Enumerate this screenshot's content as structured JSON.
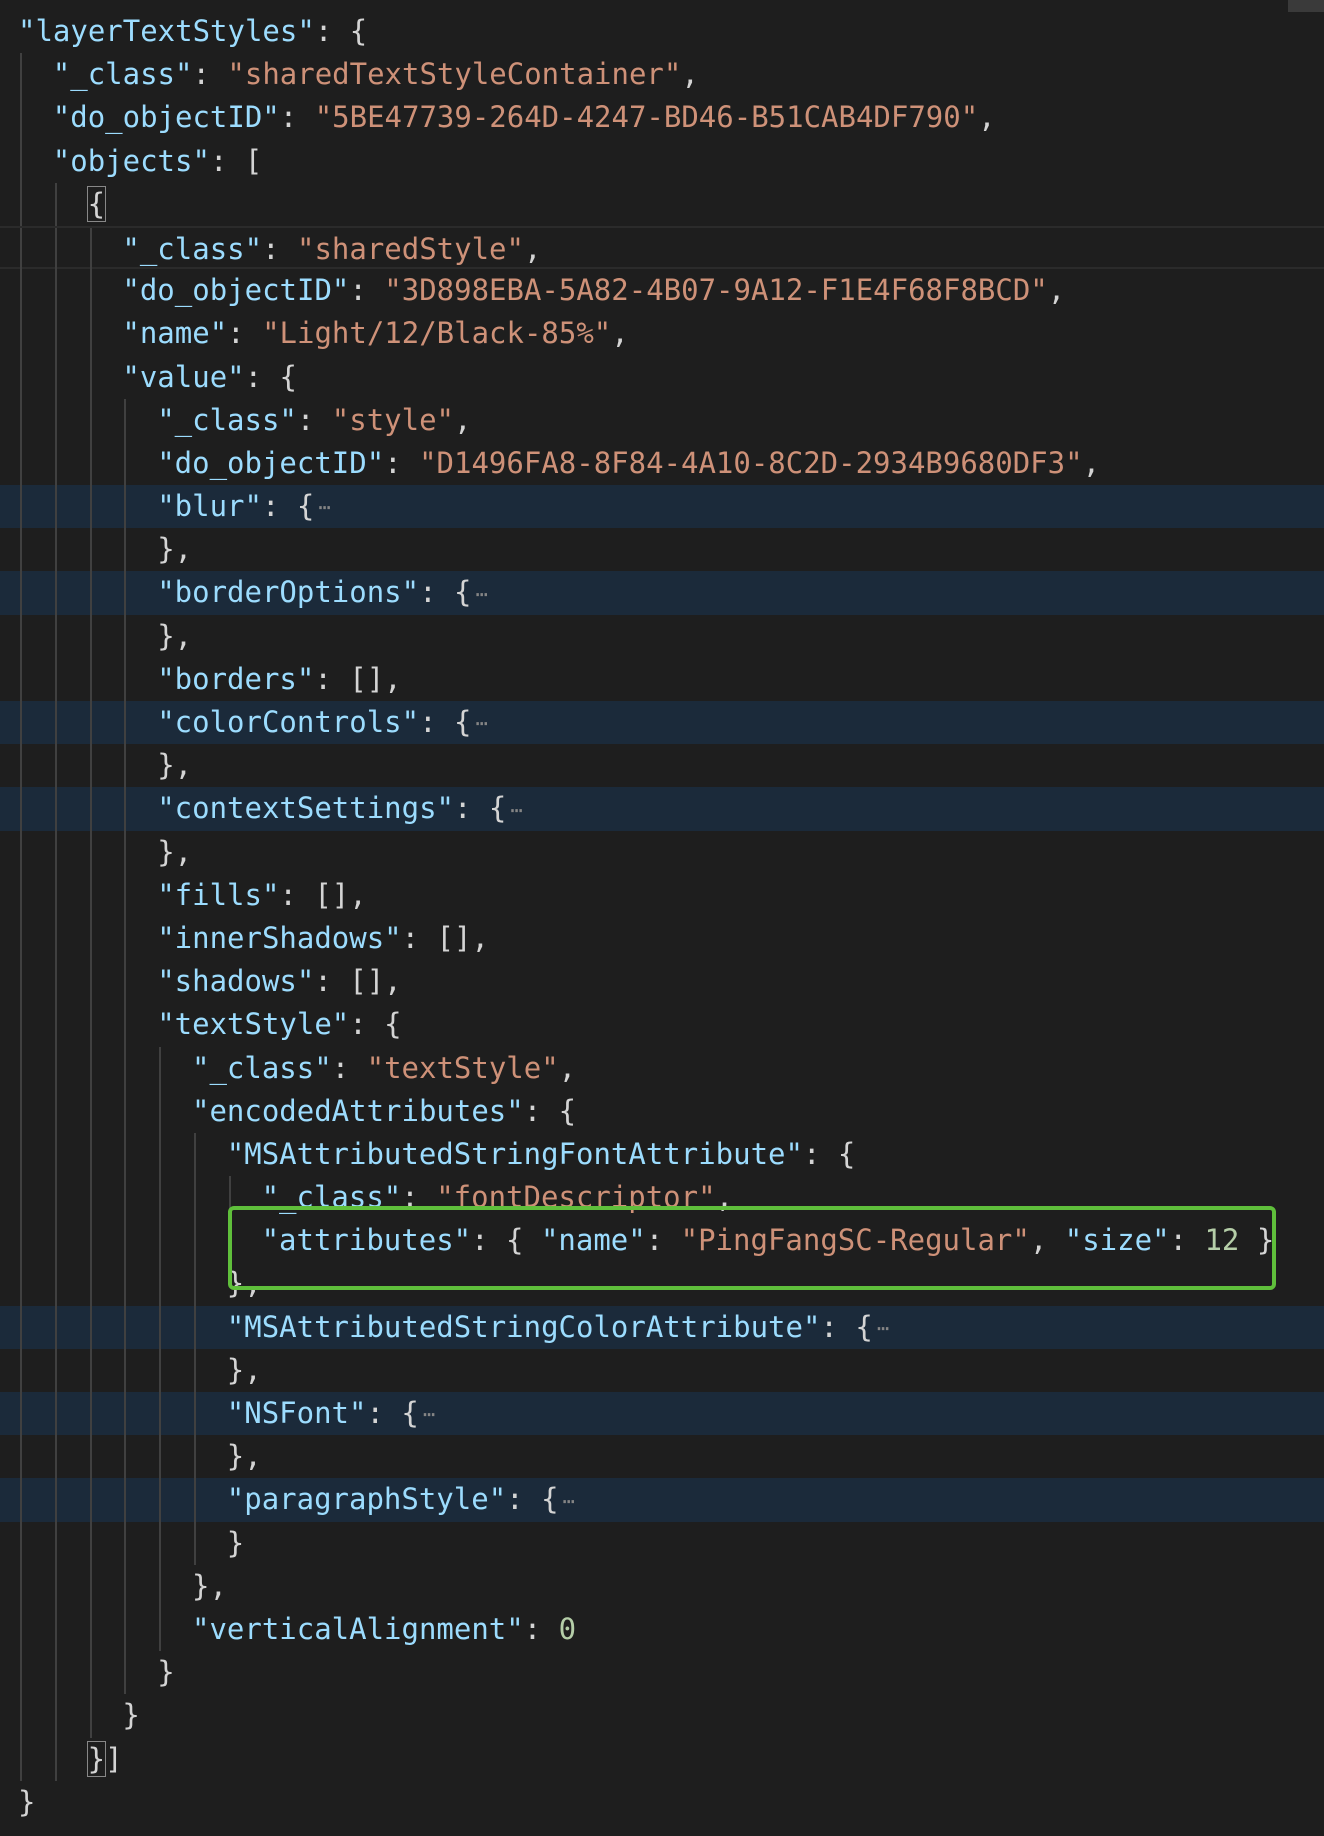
{
  "editor": {
    "language": "json",
    "colors": {
      "background": "#1e1e1e",
      "key": "#9cdcfe",
      "string": "#ce9178",
      "number": "#b5cea8",
      "punctuation": "#d4d4d4",
      "fold_highlight": "#1b2a3a",
      "annotation_box": "#5fbf3b"
    },
    "fold_icon": "ellipsis-icon",
    "lines": [
      {
        "indent": 0,
        "guides": [],
        "tokens": [
          [
            "k",
            "\"layerTextStyles\""
          ],
          [
            "p",
            ": {"
          ]
        ]
      },
      {
        "indent": 1,
        "guides": [
          0
        ],
        "tokens": [
          [
            "k",
            "\"_class\""
          ],
          [
            "p",
            ": "
          ],
          [
            "s",
            "\"sharedTextStyleContainer\""
          ],
          [
            "p",
            ","
          ]
        ]
      },
      {
        "indent": 1,
        "guides": [
          0
        ],
        "tokens": [
          [
            "k",
            "\"do_objectID\""
          ],
          [
            "p",
            ": "
          ],
          [
            "s",
            "\"5BE47739-264D-4247-BD46-B51CAB4DF790\""
          ],
          [
            "p",
            ","
          ]
        ]
      },
      {
        "indent": 1,
        "guides": [
          0
        ],
        "tokens": [
          [
            "k",
            "\"objects\""
          ],
          [
            "p",
            ": ["
          ]
        ]
      },
      {
        "indent": 2,
        "guides": [
          0,
          1
        ],
        "tokens": [
          [
            "bm",
            "{"
          ]
        ]
      },
      {
        "indent": 3,
        "guides": [
          0,
          1,
          2
        ],
        "cursor": true,
        "tokens": [
          [
            "k",
            "\"_class\""
          ],
          [
            "p",
            ": "
          ],
          [
            "s",
            "\"sharedStyle\""
          ],
          [
            "p",
            ","
          ]
        ]
      },
      {
        "indent": 3,
        "guides": [
          0,
          1,
          2
        ],
        "tokens": [
          [
            "k",
            "\"do_objectID\""
          ],
          [
            "p",
            ": "
          ],
          [
            "s",
            "\"3D898EBA-5A82-4B07-9A12-F1E4F68F8BCD\""
          ],
          [
            "p",
            ","
          ]
        ]
      },
      {
        "indent": 3,
        "guides": [
          0,
          1,
          2
        ],
        "tokens": [
          [
            "k",
            "\"name\""
          ],
          [
            "p",
            ": "
          ],
          [
            "s",
            "\"Light/12/Black-85%\""
          ],
          [
            "p",
            ","
          ]
        ]
      },
      {
        "indent": 3,
        "guides": [
          0,
          1,
          2
        ],
        "tokens": [
          [
            "k",
            "\"value\""
          ],
          [
            "p",
            ": {"
          ]
        ]
      },
      {
        "indent": 4,
        "guides": [
          0,
          1,
          2,
          3
        ],
        "tokens": [
          [
            "k",
            "\"_class\""
          ],
          [
            "p",
            ": "
          ],
          [
            "s",
            "\"style\""
          ],
          [
            "p",
            ","
          ]
        ]
      },
      {
        "indent": 4,
        "guides": [
          0,
          1,
          2,
          3
        ],
        "tokens": [
          [
            "k",
            "\"do_objectID\""
          ],
          [
            "p",
            ": "
          ],
          [
            "s",
            "\"D1496FA8-8F84-4A10-8C2D-2934B9680DF3\""
          ],
          [
            "p",
            ","
          ]
        ]
      },
      {
        "indent": 4,
        "guides": [
          0,
          1,
          2,
          3
        ],
        "folded": true,
        "tokens": [
          [
            "k",
            "\"blur\""
          ],
          [
            "p",
            ": {"
          ]
        ]
      },
      {
        "indent": 4,
        "guides": [
          0,
          1,
          2,
          3
        ],
        "tokens": [
          [
            "p",
            "},"
          ]
        ]
      },
      {
        "indent": 4,
        "guides": [
          0,
          1,
          2,
          3
        ],
        "folded": true,
        "tokens": [
          [
            "k",
            "\"borderOptions\""
          ],
          [
            "p",
            ": {"
          ]
        ]
      },
      {
        "indent": 4,
        "guides": [
          0,
          1,
          2,
          3
        ],
        "tokens": [
          [
            "p",
            "},"
          ]
        ]
      },
      {
        "indent": 4,
        "guides": [
          0,
          1,
          2,
          3
        ],
        "tokens": [
          [
            "k",
            "\"borders\""
          ],
          [
            "p",
            ": [],"
          ]
        ]
      },
      {
        "indent": 4,
        "guides": [
          0,
          1,
          2,
          3
        ],
        "folded": true,
        "tokens": [
          [
            "k",
            "\"colorControls\""
          ],
          [
            "p",
            ": {"
          ]
        ]
      },
      {
        "indent": 4,
        "guides": [
          0,
          1,
          2,
          3
        ],
        "tokens": [
          [
            "p",
            "},"
          ]
        ]
      },
      {
        "indent": 4,
        "guides": [
          0,
          1,
          2,
          3
        ],
        "folded": true,
        "tokens": [
          [
            "k",
            "\"contextSettings\""
          ],
          [
            "p",
            ": {"
          ]
        ]
      },
      {
        "indent": 4,
        "guides": [
          0,
          1,
          2,
          3
        ],
        "tokens": [
          [
            "p",
            "},"
          ]
        ]
      },
      {
        "indent": 4,
        "guides": [
          0,
          1,
          2,
          3
        ],
        "tokens": [
          [
            "k",
            "\"fills\""
          ],
          [
            "p",
            ": [],"
          ]
        ]
      },
      {
        "indent": 4,
        "guides": [
          0,
          1,
          2,
          3
        ],
        "tokens": [
          [
            "k",
            "\"innerShadows\""
          ],
          [
            "p",
            ": [],"
          ]
        ]
      },
      {
        "indent": 4,
        "guides": [
          0,
          1,
          2,
          3
        ],
        "tokens": [
          [
            "k",
            "\"shadows\""
          ],
          [
            "p",
            ": [],"
          ]
        ]
      },
      {
        "indent": 4,
        "guides": [
          0,
          1,
          2,
          3
        ],
        "tokens": [
          [
            "k",
            "\"textStyle\""
          ],
          [
            "p",
            ": {"
          ]
        ]
      },
      {
        "indent": 5,
        "guides": [
          0,
          1,
          2,
          3,
          4
        ],
        "tokens": [
          [
            "k",
            "\"_class\""
          ],
          [
            "p",
            ": "
          ],
          [
            "s",
            "\"textStyle\""
          ],
          [
            "p",
            ","
          ]
        ]
      },
      {
        "indent": 5,
        "guides": [
          0,
          1,
          2,
          3,
          4
        ],
        "tokens": [
          [
            "k",
            "\"encodedAttributes\""
          ],
          [
            "p",
            ": {"
          ]
        ]
      },
      {
        "indent": 6,
        "guides": [
          0,
          1,
          2,
          3,
          4,
          5
        ],
        "tokens": [
          [
            "k",
            "\"MSAttributedStringFontAttribute\""
          ],
          [
            "p",
            ": {"
          ]
        ]
      },
      {
        "indent": 7,
        "guides": [
          0,
          1,
          2,
          3,
          4,
          5,
          6
        ],
        "tokens": [
          [
            "k",
            "\"_class\""
          ],
          [
            "p",
            ": "
          ],
          [
            "s",
            "\"fontDescriptor\""
          ],
          [
            "p",
            ","
          ]
        ]
      },
      {
        "indent": 7,
        "guides": [
          0,
          1,
          2,
          3,
          4,
          5,
          6
        ],
        "tokens": [
          [
            "k",
            "\"attributes\""
          ],
          [
            "p",
            ": { "
          ],
          [
            "k",
            "\"name\""
          ],
          [
            "p",
            ": "
          ],
          [
            "s",
            "\"PingFangSC-Regular\""
          ],
          [
            "p",
            ", "
          ],
          [
            "k",
            "\"size\""
          ],
          [
            "p",
            ": "
          ],
          [
            "n",
            "12"
          ],
          [
            "p",
            " }"
          ]
        ]
      },
      {
        "indent": 6,
        "guides": [
          0,
          1,
          2,
          3,
          4,
          5
        ],
        "tokens": [
          [
            "p",
            "},"
          ]
        ]
      },
      {
        "indent": 6,
        "guides": [
          0,
          1,
          2,
          3,
          4,
          5
        ],
        "folded": true,
        "tokens": [
          [
            "k",
            "\"MSAttributedStringColorAttribute\""
          ],
          [
            "p",
            ": {"
          ]
        ]
      },
      {
        "indent": 6,
        "guides": [
          0,
          1,
          2,
          3,
          4,
          5
        ],
        "tokens": [
          [
            "p",
            "},"
          ]
        ]
      },
      {
        "indent": 6,
        "guides": [
          0,
          1,
          2,
          3,
          4,
          5
        ],
        "folded": true,
        "tokens": [
          [
            "k",
            "\"NSFont\""
          ],
          [
            "p",
            ": {"
          ]
        ]
      },
      {
        "indent": 6,
        "guides": [
          0,
          1,
          2,
          3,
          4,
          5
        ],
        "tokens": [
          [
            "p",
            "},"
          ]
        ]
      },
      {
        "indent": 6,
        "guides": [
          0,
          1,
          2,
          3,
          4,
          5
        ],
        "folded": true,
        "tokens": [
          [
            "k",
            "\"paragraphStyle\""
          ],
          [
            "p",
            ": {"
          ]
        ]
      },
      {
        "indent": 6,
        "guides": [
          0,
          1,
          2,
          3,
          4,
          5
        ],
        "tokens": [
          [
            "p",
            "}"
          ]
        ]
      },
      {
        "indent": 5,
        "guides": [
          0,
          1,
          2,
          3,
          4
        ],
        "tokens": [
          [
            "p",
            "},"
          ]
        ]
      },
      {
        "indent": 5,
        "guides": [
          0,
          1,
          2,
          3,
          4
        ],
        "tokens": [
          [
            "k",
            "\"verticalAlignment\""
          ],
          [
            "p",
            ": "
          ],
          [
            "n",
            "0"
          ]
        ]
      },
      {
        "indent": 4,
        "guides": [
          0,
          1,
          2,
          3
        ],
        "tokens": [
          [
            "p",
            "}"
          ]
        ]
      },
      {
        "indent": 3,
        "guides": [
          0,
          1,
          2
        ],
        "tokens": [
          [
            "p",
            "}"
          ]
        ]
      },
      {
        "indent": 2,
        "guides": [
          0,
          1
        ],
        "tokens": [
          [
            "bm",
            "}"
          ],
          [
            "p",
            "]"
          ]
        ]
      },
      {
        "indent": 0,
        "guides": [],
        "tokens": [
          [
            "p",
            "}"
          ]
        ]
      }
    ]
  }
}
